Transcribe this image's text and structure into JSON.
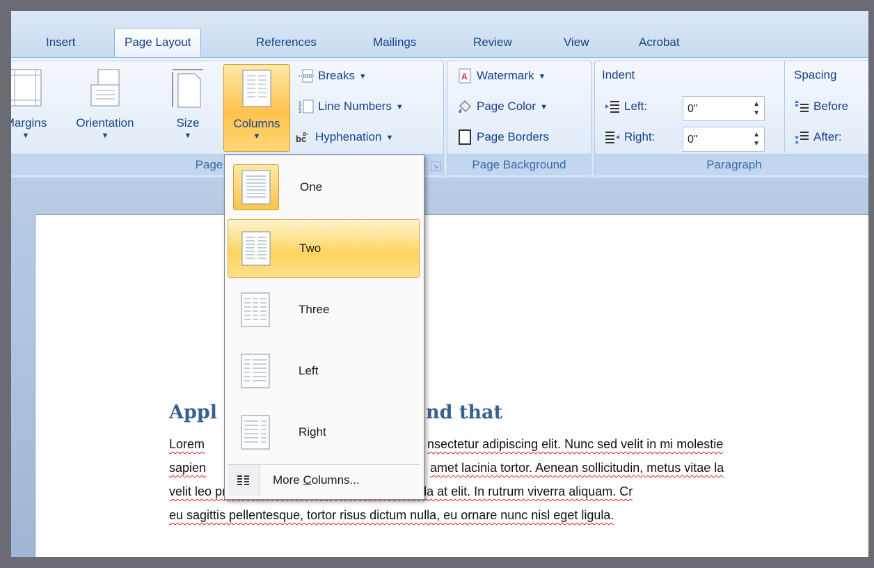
{
  "tabs": [
    "Insert",
    "Page Layout",
    "References",
    "Mailings",
    "Review",
    "View",
    "Acrobat"
  ],
  "page_setup": {
    "margins_label": "Margins",
    "orientation_label": "Orientation",
    "size_label": "Size",
    "columns_label": "Columns",
    "breaks_label": "Breaks",
    "line_numbers_label": "Line Numbers",
    "hyphenation_label": "Hyphenation",
    "group_label": "Page Setup"
  },
  "page_background": {
    "watermark_label": "Watermark",
    "page_color_label": "Page Color",
    "page_borders_label": "Page Borders",
    "group_label": "Page Background"
  },
  "paragraph": {
    "indent_label": "Indent",
    "left_label": "Left:",
    "left_value": "0\"",
    "right_label": "Right:",
    "right_value": "0\"",
    "spacing_label": "Spacing",
    "before_label": "Before",
    "after_label": "After:",
    "group_label": "Paragraph"
  },
  "columns_menu": {
    "items": [
      "One",
      "Two",
      "Three",
      "Left",
      "Right"
    ],
    "selected": "Two",
    "more_prefix": "More ",
    "more_accel": "C",
    "more_suffix": "olumns..."
  },
  "document": {
    "heading_visible_left": "Appl",
    "heading_visible_right": "nd that",
    "lines": [
      {
        "left": "Lorem",
        "right": "nsectetur adipiscing elit. Nunc sed velit in mi molestie"
      },
      {
        "left": "sapien",
        "right": "amet lacinia tortor. Aenean sollicitudin, metus vitae la"
      },
      {
        "left": "velit leo pretium mauris, nec ultrices lacus ligula at elit. In rutrum viverra aliquam. Cr",
        "right": ""
      },
      {
        "left": "eu sagittis pellentesque, tortor risus dictum nulla, eu ornare nunc nisl eget ligula.",
        "right": ""
      }
    ]
  },
  "colors": {
    "ribbon_text": "#15428b",
    "highlight": "#ffc34d",
    "heading": "#376092"
  }
}
